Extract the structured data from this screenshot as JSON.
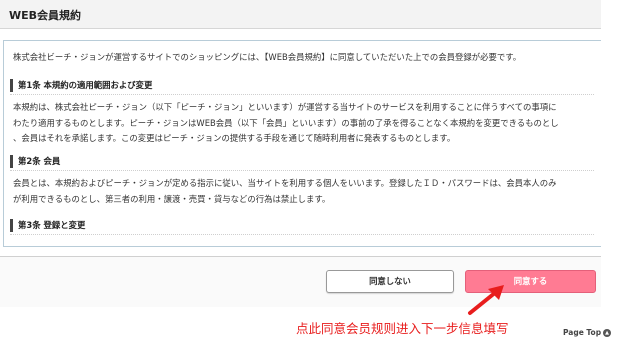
{
  "page": {
    "title": "WEB会員規約"
  },
  "terms": {
    "intro": "株式会社ビーチ・ジョンが運営するサイトでのショッピングには、【WEB会員規約】に同意していただいた上での会員登録が必要です。",
    "sections": [
      {
        "heading": "第1条 本規約の適用範囲および変更",
        "lines": [
          "本規約は、株式会社ピーチ・ジョン（以下「ピーチ・ジョン」といいます）が運営する当サイトのサービスを利用することに伴うすべての事項に",
          "わたり適用するものとします。ピーチ・ジョンはWEB会員（以下「会員」といいます）の事前の了承を得ることなく本規約を変更できるものとし",
          "、会員はそれを承諾します。この変更はピーチ・ジョンの提供する手段を通じて随時利用者に発表するものとします。"
        ]
      },
      {
        "heading": "第2条 会員",
        "lines": [
          "会員とは、本規約およびピーチ・ジョンが定める指示に従い、当サイトを利用する個人をいいます。登録したＩＤ・パスワードは、会員本人のみ",
          "が利用できるものとし、第三者の利用・譲渡・売買・貸与などの行為は禁止します。"
        ]
      },
      {
        "heading": "第3条 登録と変更",
        "lines": []
      }
    ]
  },
  "buttons": {
    "disagree": "同意しない",
    "agree": "同意する"
  },
  "annotation": {
    "text": "点此同意会员规则进入下一步信息填写",
    "color": "#e81d1d"
  },
  "page_top": {
    "label": "Page Top"
  },
  "colors": {
    "agree_button": "#ff7b93",
    "panel_border": "#b8ccd8"
  }
}
